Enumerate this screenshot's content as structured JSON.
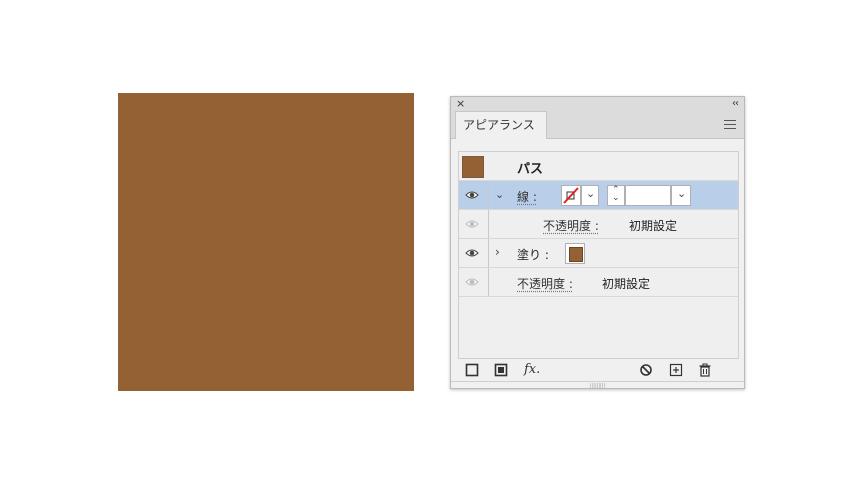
{
  "canvas": {
    "fill_color": "#946134"
  },
  "panel": {
    "close_glyph": "×",
    "collapse_glyph": "‹‹",
    "tab_label": "アピアランス",
    "object": {
      "label": "パス",
      "color": "#946134"
    },
    "stroke": {
      "label": "線 :"
    },
    "stroke_opacity": {
      "label": "不透明度 :",
      "value": "初期設定"
    },
    "fill": {
      "label": "塗り :",
      "color": "#946134"
    },
    "object_opacity": {
      "label": "不透明度 :",
      "value": "初期設定"
    },
    "footer": {
      "fx_label": "fx."
    },
    "grip": "|||||||||"
  },
  "colors": {
    "selection": "#b9cfe9",
    "stroke_none_red": "#e0201a"
  }
}
